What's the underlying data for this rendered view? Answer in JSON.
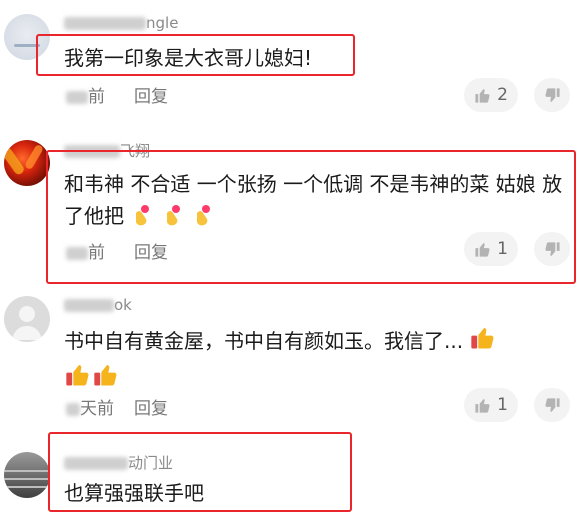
{
  "comments": [
    {
      "username": "ngle",
      "text": "我第一印象是大衣哥儿媳妇!",
      "time": "前",
      "reply": "回复",
      "likes": "2"
    },
    {
      "username": "飞翔",
      "text": "和韦神 不合适 一个张扬 一个低调 不是韦神的菜 姑娘 放了他把",
      "time": "前",
      "reply": "回复",
      "likes": "1"
    },
    {
      "username": "ok",
      "text": "书中自有黄金屋，书中自有颜如玉。我信了...",
      "time": "天前",
      "reply": "回复",
      "likes": "1"
    },
    {
      "username": "动门业",
      "text": "也算强强联手吧"
    }
  ],
  "colors": {
    "highlight": "#e8262b",
    "meta": "#777777",
    "button_bg": "#f3f3f3"
  },
  "icons": [
    "thumbs-up-icon",
    "thumbs-down-icon",
    "heart-hands-emoji",
    "thumbs-up-emoji"
  ]
}
